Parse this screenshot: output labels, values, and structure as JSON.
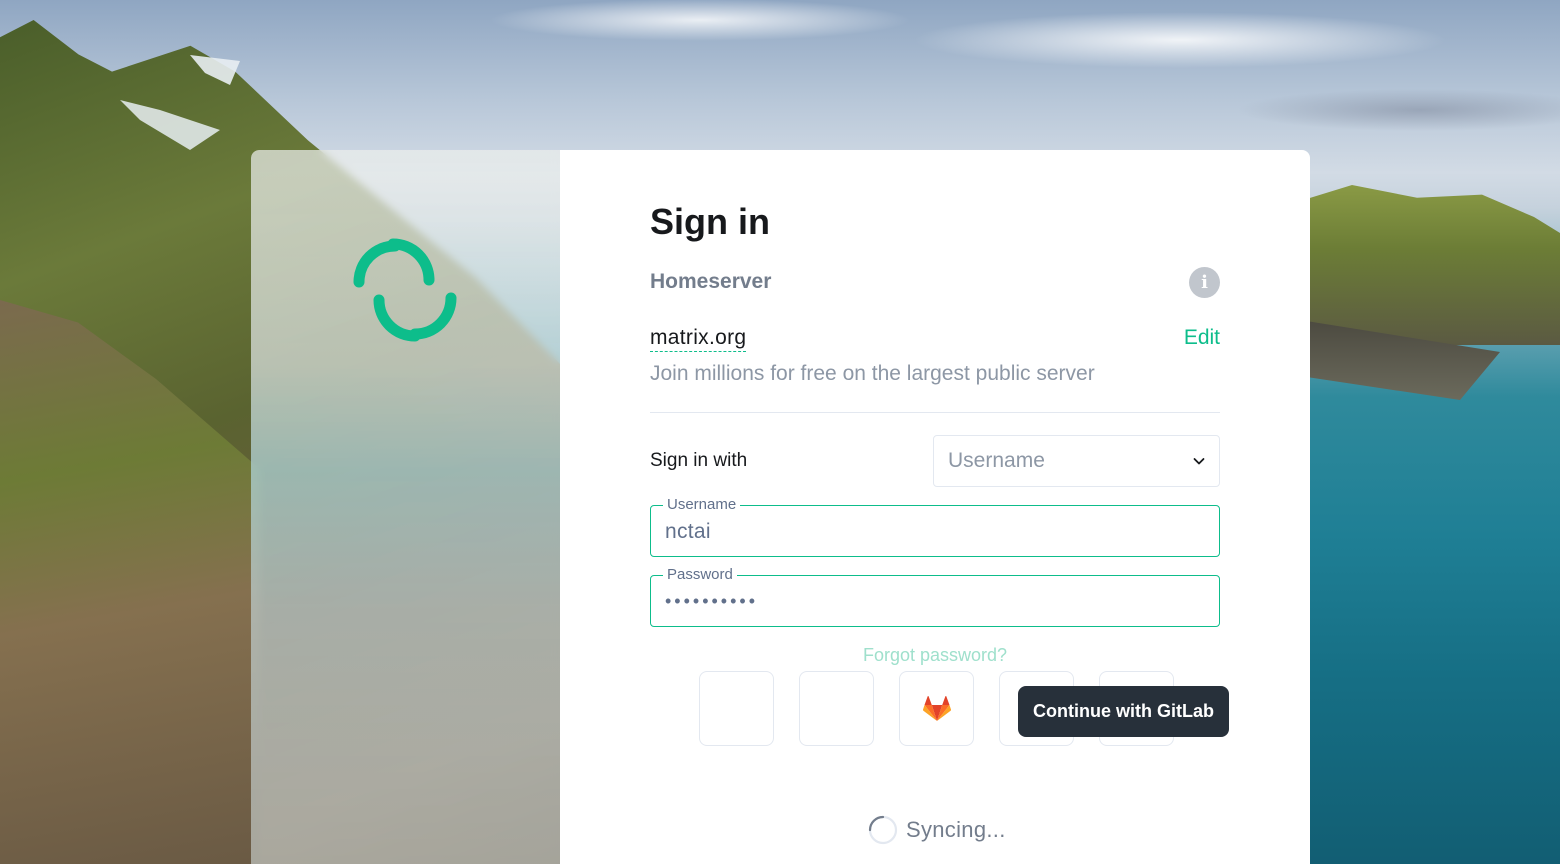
{
  "page": {
    "title": "Sign in"
  },
  "homeserver": {
    "label": "Homeserver",
    "info_icon": "info-icon",
    "server_name": "matrix.org",
    "edit_label": "Edit",
    "description": "Join millions for free on the largest public server"
  },
  "signin_with": {
    "label": "Sign in with",
    "selected": "Username",
    "chevron_icon": "chevron-down-icon"
  },
  "username_field": {
    "label": "Username",
    "value": "nctai"
  },
  "password_field": {
    "label": "Password",
    "value": "••••••••••"
  },
  "forgot_password": "Forgot password?",
  "sso": {
    "buttons": [
      {
        "name": "sso-button-1",
        "icon": "blank"
      },
      {
        "name": "sso-button-2",
        "icon": "blank"
      },
      {
        "name": "gitlab",
        "icon": "gitlab-icon"
      },
      {
        "name": "facebook",
        "icon": "facebook-icon"
      },
      {
        "name": "apple",
        "icon": "apple-icon"
      }
    ],
    "tooltip": "Continue with GitLab"
  },
  "status": {
    "text": "Syncing..."
  },
  "colors": {
    "accent": "#0dbd8b",
    "tooltip_bg": "#27303a",
    "facebook": "#1877f2"
  }
}
